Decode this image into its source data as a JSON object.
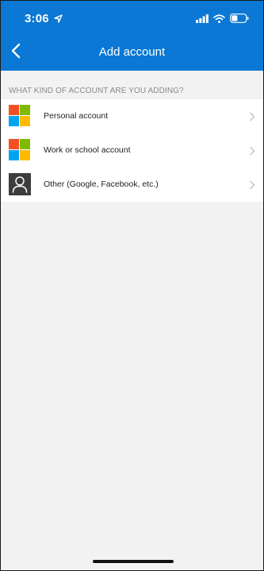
{
  "status_bar": {
    "time": "3:06",
    "icons": [
      "location-arrow-icon",
      "signal-bars-icon",
      "wifi-icon",
      "battery-icon"
    ]
  },
  "nav": {
    "title": "Add account",
    "back_icon": "chevron-left-icon"
  },
  "section": {
    "header": "WHAT KIND OF ACCOUNT ARE YOU ADDING?"
  },
  "accounts": [
    {
      "label": "Personal account",
      "icon": "microsoft-logo-icon"
    },
    {
      "label": "Work or school account",
      "icon": "microsoft-logo-icon"
    },
    {
      "label": "Other (Google, Facebook, etc.)",
      "icon": "person-icon"
    }
  ],
  "colors": {
    "header_blue": "#0a78d4",
    "background": "#f2f2f2",
    "ms_red": "#f25022",
    "ms_green": "#7fba00",
    "ms_blue": "#00a4ef",
    "ms_yellow": "#ffb900"
  }
}
